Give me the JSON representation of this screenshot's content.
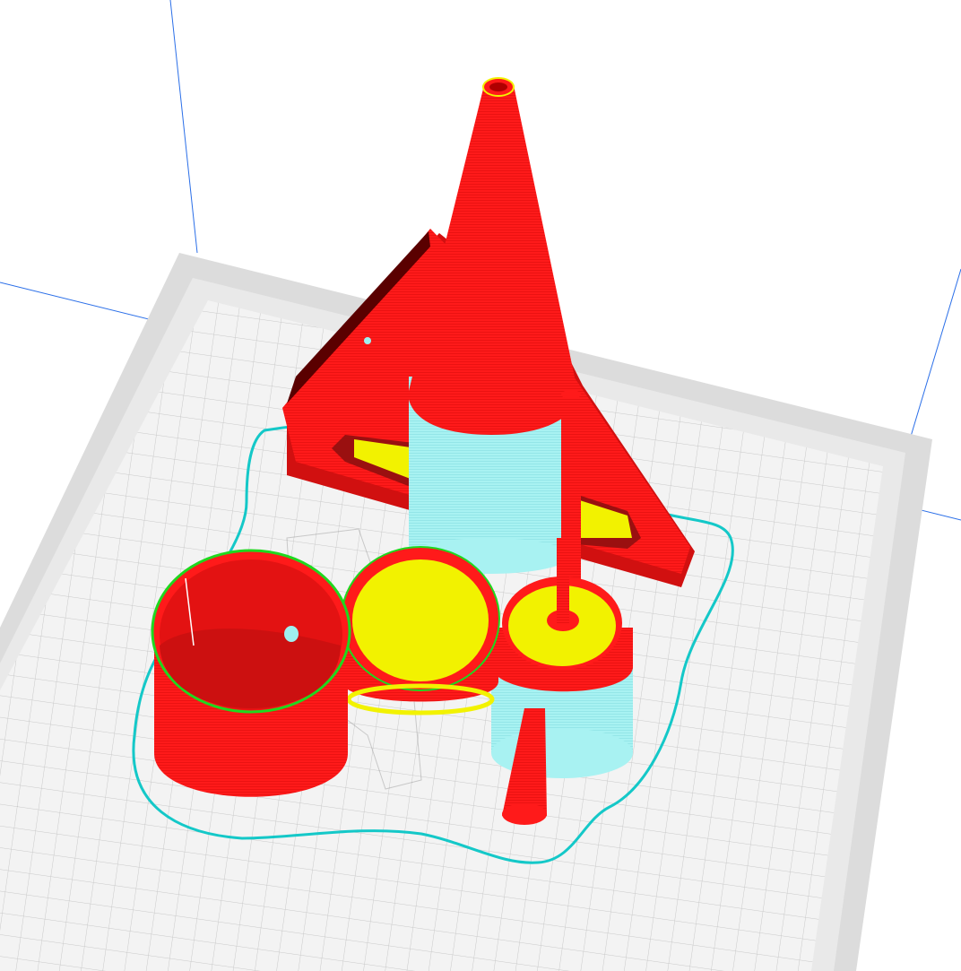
{
  "app": {
    "view": "slicer-preview",
    "mode": "layer-preview"
  },
  "colors": {
    "background": "#ffffff",
    "bed_outer": "#dcdcdc",
    "bed_border": "#e6e6e6",
    "bed_inner": "#f3f3f3",
    "grid_line": "#c9c9c9",
    "build_volume_edge": "#2b6fe8",
    "wall_outer": "#ff1a1a",
    "wall_inner_green": "#1fd81f",
    "infill_yellow": "#f2f200",
    "support_cyan": "#9ff0f0",
    "skirt_cyan": "#14c8c8",
    "shadow_dark": "#5a0000"
  },
  "objects": [
    {
      "name": "cone",
      "feature": "wall-outer"
    },
    {
      "name": "triangle-frame",
      "feature": "wall-outer"
    },
    {
      "name": "cylinder-cup",
      "feature": "wall-outer"
    },
    {
      "name": "lid-disc",
      "feature": "top-skin"
    },
    {
      "name": "stand-pillar",
      "feature": "wall-outer"
    }
  ],
  "legend_icons": {
    "bed": "print-bed-icon",
    "skirt": "skirt-outline-icon",
    "support": "support-structure-icon"
  }
}
